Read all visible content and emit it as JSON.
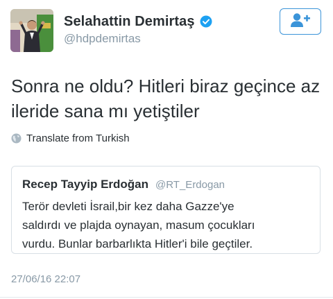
{
  "author": {
    "display_name": "Selahattin Demirtaş",
    "handle": "@hdpdemirtas",
    "verified_icon": "verified-badge-icon",
    "avatar_icon": "profile-photo"
  },
  "follow_button": {
    "icon": "add-user-icon"
  },
  "tweet": {
    "text_line1": "Sonra ne oldu? Hitleri biraz geçince az",
    "text_line2": "ileride sana mı yetiştiler",
    "translate_label": "Translate from Turkish",
    "translate_icon": "globe-icon",
    "timestamp": "27/06/16 22:07"
  },
  "quoted_tweet": {
    "display_name": "Recep Tayyip Erdoğan",
    "handle": "@RT_Erdogan",
    "text_line1": "Terör devleti İsrail,bir kez daha Gazze'ye",
    "text_line2": "saldırdı ve plajda oynayan, masum çocukları",
    "text_line3": "vurdu. Bunlar barbarlıkta Hitler'i bile geçtiler."
  },
  "colors": {
    "accent": "#3b94d9",
    "text": "#292f33",
    "muted": "#8899a6",
    "border": "#d8dfe5"
  }
}
